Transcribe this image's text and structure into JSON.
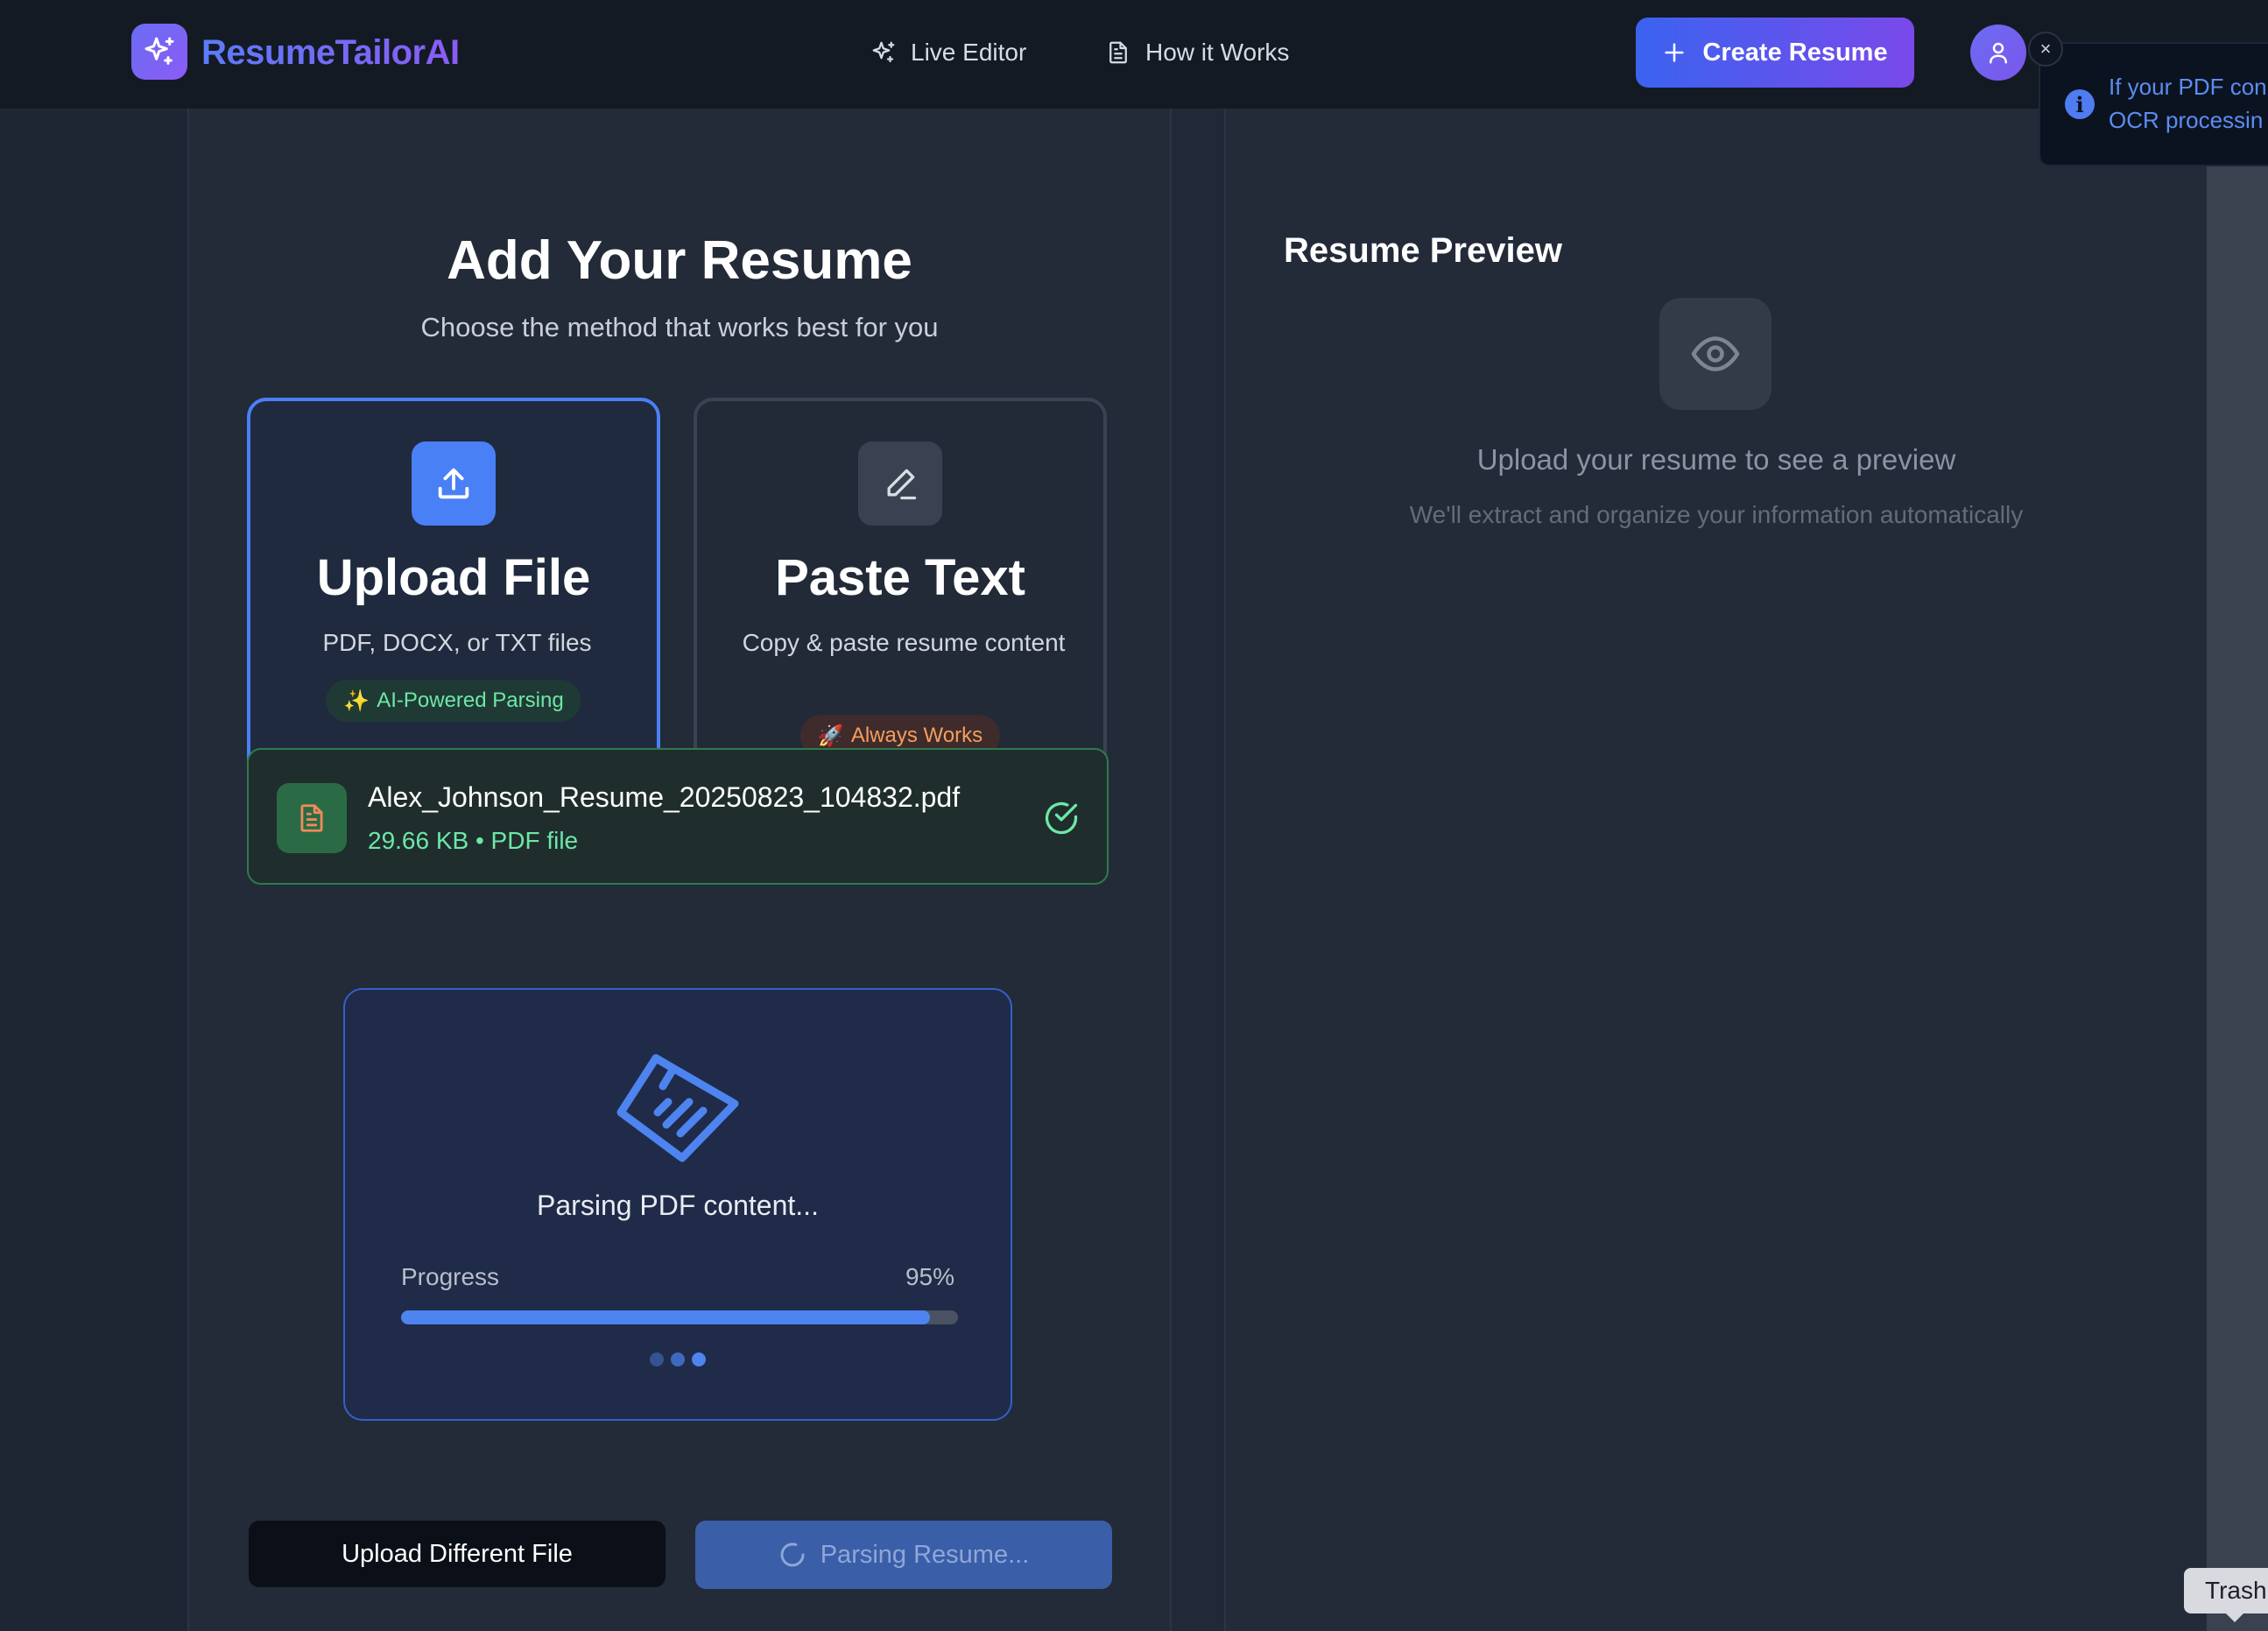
{
  "app": {
    "name": "ResumeTailorAI"
  },
  "nav": {
    "live_editor": "Live Editor",
    "how_it_works": "How it Works",
    "create_resume": "Create Resume"
  },
  "toast": {
    "line1": "If your PDF con",
    "line2": "OCR processin"
  },
  "left": {
    "title": "Add Your Resume",
    "subtitle": "Choose the method that works best for you",
    "upload_card": {
      "title": "Upload File",
      "desc": "PDF, DOCX, or TXT files",
      "badge": "AI-Powered Parsing"
    },
    "paste_card": {
      "title": "Paste Text",
      "desc": "Copy & paste resume content",
      "badge": "Always Works"
    },
    "file": {
      "name": "Alex_Johnson_Resume_20250823_104832.pdf",
      "meta": "29.66 KB • PDF file"
    },
    "parsing": {
      "status": "Parsing PDF content...",
      "progress_label": "Progress",
      "progress_value": "95%",
      "progress_fraction": 0.95
    },
    "buttons": {
      "upload_different": "Upload Different File",
      "parsing": "Parsing Resume..."
    }
  },
  "right": {
    "title": "Resume Preview",
    "empty_message": "Upload your resume to see a preview",
    "empty_sub": "We'll extract and organize your information automatically"
  },
  "tooltip": {
    "trash": "Trash"
  },
  "colors": {
    "accent": "#4a80f5",
    "brand_gradient_start": "#3b63f0",
    "brand_gradient_end": "#7a49ea",
    "success": "#6ee7a8",
    "warning": "#f59e5b"
  },
  "icons": {
    "logo": "sparkles-icon",
    "live_editor": "sparkles-icon",
    "how_it_works": "document-icon",
    "create": "plus-icon",
    "avatar": "user-icon",
    "close": "close-icon",
    "info": "info-icon",
    "upload": "upload-icon",
    "paste": "pencil-icon",
    "file": "file-text-icon",
    "check": "check-circle-icon",
    "parse": "file-scan-icon",
    "spinner": "spinner-icon",
    "preview": "eye-icon"
  }
}
